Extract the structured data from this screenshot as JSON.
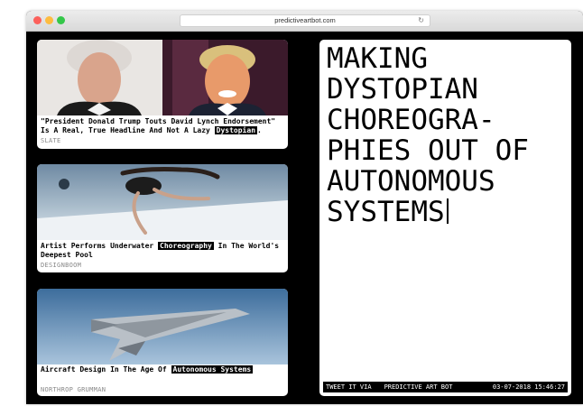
{
  "browser": {
    "url": "predictiveartbot.com",
    "reload_icon": "reload-icon"
  },
  "articles": [
    {
      "headline_before": "\"President Donald Trump Touts David Lynch Endorsement\" Is A Real, True Headline And Not A Lazy ",
      "keyword": "Dystopian",
      "headline_after": ".",
      "source": "SLATE"
    },
    {
      "headline_before": "Artist Performs Underwater ",
      "keyword": "Choreography",
      "headline_after": " In The World's Deepest Pool",
      "source": "DESIGNBOOM"
    },
    {
      "headline_before": "Aircraft Design In The Age Of ",
      "keyword": "Autonomous Systems",
      "headline_after": "",
      "source": "NORTHROP GRUMMAN"
    }
  ],
  "generated": {
    "title": "MAKING DYSTOPIAN CHOREOGRA- PHIES OUT OF AUTONOMOUS SYSTEMS",
    "tweet_label": "TWEET IT VIA",
    "bot_name": "PREDICTIVE ART BOT",
    "timestamp": "03-07-2018 15:46:27"
  },
  "colors": {
    "background": "#000000",
    "card": "#ffffff",
    "highlight_bg": "#000000",
    "highlight_fg": "#ffffff",
    "source_text": "#888888"
  }
}
